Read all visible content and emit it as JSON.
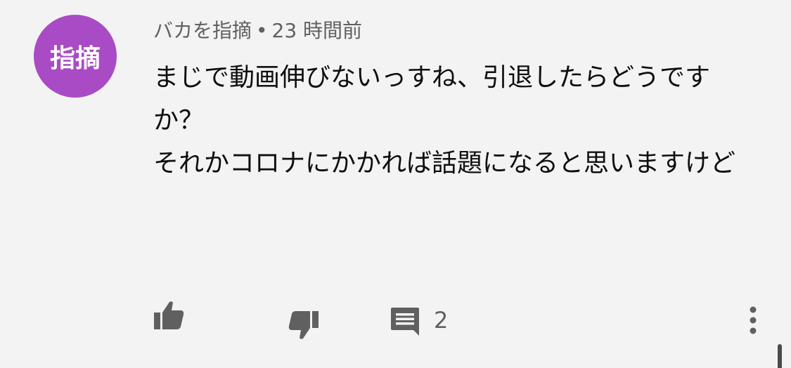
{
  "comment": {
    "avatar_text": "指摘",
    "author": "バカを指摘",
    "separator": "•",
    "time": "23 時間前",
    "paragraphs": [
      "まじで動画伸びないっすね、引退したらどうですか？",
      "それかコロナにかかれば話題になると思いますけど"
    ],
    "reply_count": "2"
  },
  "actions": {
    "like_icon": "thumb-up-icon",
    "dislike_icon": "thumb-down-icon",
    "reply_icon": "comment-icon",
    "more_icon": "more-vertical-icon"
  },
  "colors": {
    "background": "#f3f3f3",
    "avatar": "#a94bc4",
    "icon": "#606060",
    "text": "#0f0f0f"
  }
}
